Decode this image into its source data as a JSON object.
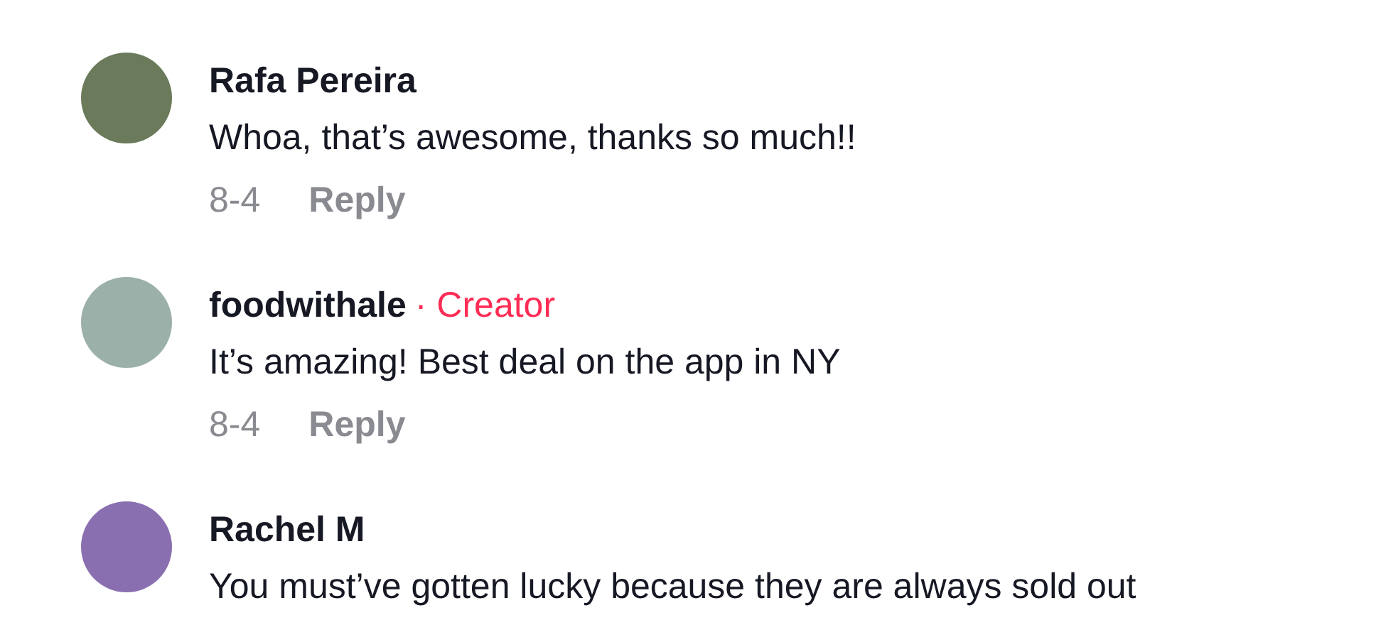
{
  "comments": [
    {
      "author": "Rafa Pereira",
      "text": "Whoa, that’s awesome, thanks so much!!",
      "date": "8-4",
      "reply": "Reply"
    },
    {
      "author": "foodwithale",
      "badge": "· Creator",
      "text": "It’s amazing! Best deal on the app in NY",
      "date": "8-4",
      "reply": "Reply"
    },
    {
      "author": "Rachel M",
      "text": "You must’ve gotten lucky because they are always sold out"
    }
  ]
}
